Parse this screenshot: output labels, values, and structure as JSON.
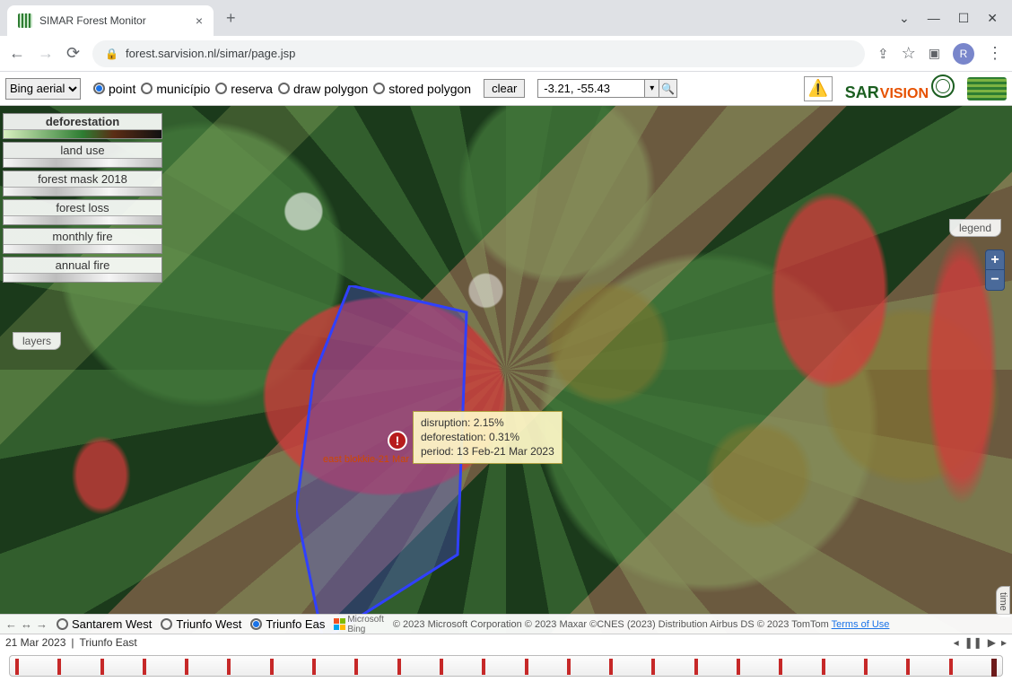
{
  "browser": {
    "tab_title": "SIMAR Forest Monitor",
    "url": "forest.sarvision.nl/simar/page.jsp",
    "profile_initial": "R"
  },
  "toolbar": {
    "basemap_selected": "Bing aerial",
    "mode_options": [
      "point",
      "município",
      "reserva",
      "draw polygon",
      "stored polygon"
    ],
    "mode_selected": "point",
    "clear_label": "clear",
    "coord_value": "-3.21, -55.43",
    "brand_sar": "SAR",
    "brand_vision": "VISION"
  },
  "layers": {
    "tab_label": "layers",
    "legend_label": "legend",
    "items": [
      {
        "label": "deforestation",
        "active": true,
        "grad": "grad-defo"
      },
      {
        "label": "land use",
        "active": false,
        "grad": "grad-grey"
      },
      {
        "label": "forest mask 2018",
        "active": false,
        "grad": "grad-grey"
      },
      {
        "label": "forest loss",
        "active": false,
        "grad": "grad-grey"
      },
      {
        "label": "monthly fire",
        "active": false,
        "grad": "grad-grey"
      },
      {
        "label": "annual fire",
        "active": false,
        "grad": "grad-grey"
      }
    ]
  },
  "alert": {
    "line1": "disruption: 2.15%",
    "line2": "deforestation: 0.31%",
    "line3": "period: 13 Feb-21 Mar 2023",
    "poly_label": "east blokkie-21 Mar 2023"
  },
  "region_bar": {
    "options": [
      "Santarem West",
      "Triunfo West",
      "Triunfo East"
    ],
    "selected": "Triunfo East",
    "bing_label": "Microsoft\nBing",
    "attribution": "© 2023 Microsoft Corporation © 2023 Maxar ©CNES (2023) Distribution Airbus DS © 2023 TomTom ",
    "terms": "Terms of Use"
  },
  "status": {
    "date": "21 Mar 2023",
    "region": "Triunfo East",
    "time_tab": "time"
  },
  "timeline": {
    "tick_count": 24,
    "current_index": 23
  }
}
